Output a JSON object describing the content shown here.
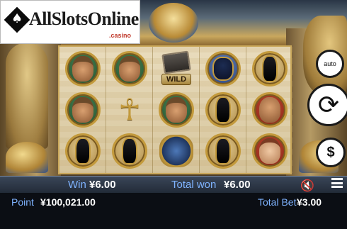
{
  "logo": {
    "brand": "AllSlotsOnline",
    "domain": ".casino"
  },
  "wild_label": "WILD",
  "reels": [
    [
      "explorer-man",
      "explorer-man",
      "cat-statue"
    ],
    [
      "explorer-man",
      "ankh",
      "cat-statue"
    ],
    [
      "wild-book",
      "explorer-man",
      "scarab"
    ],
    [
      "anubis-guard",
      "cat-statue",
      "cat-statue"
    ],
    [
      "cat-statue",
      "man-portrait",
      "woman-portrait"
    ]
  ],
  "controls": {
    "auto_label": "auto",
    "spin_glyph": "⟳",
    "bet_glyph": "$"
  },
  "winbar": {
    "win_label": "Win",
    "win_value": "¥6.00",
    "total_won_label": "Total won",
    "total_won_value": "¥6.00"
  },
  "infobar": {
    "point_label": "Point",
    "point_value": "¥100,021.00",
    "total_bet_label": "Total Bet",
    "total_bet_value": "¥3.00"
  },
  "colors": {
    "accent_gold": "#c39a3c",
    "label_blue": "#7fb3ff",
    "bar_bg": "#0b0e14"
  }
}
